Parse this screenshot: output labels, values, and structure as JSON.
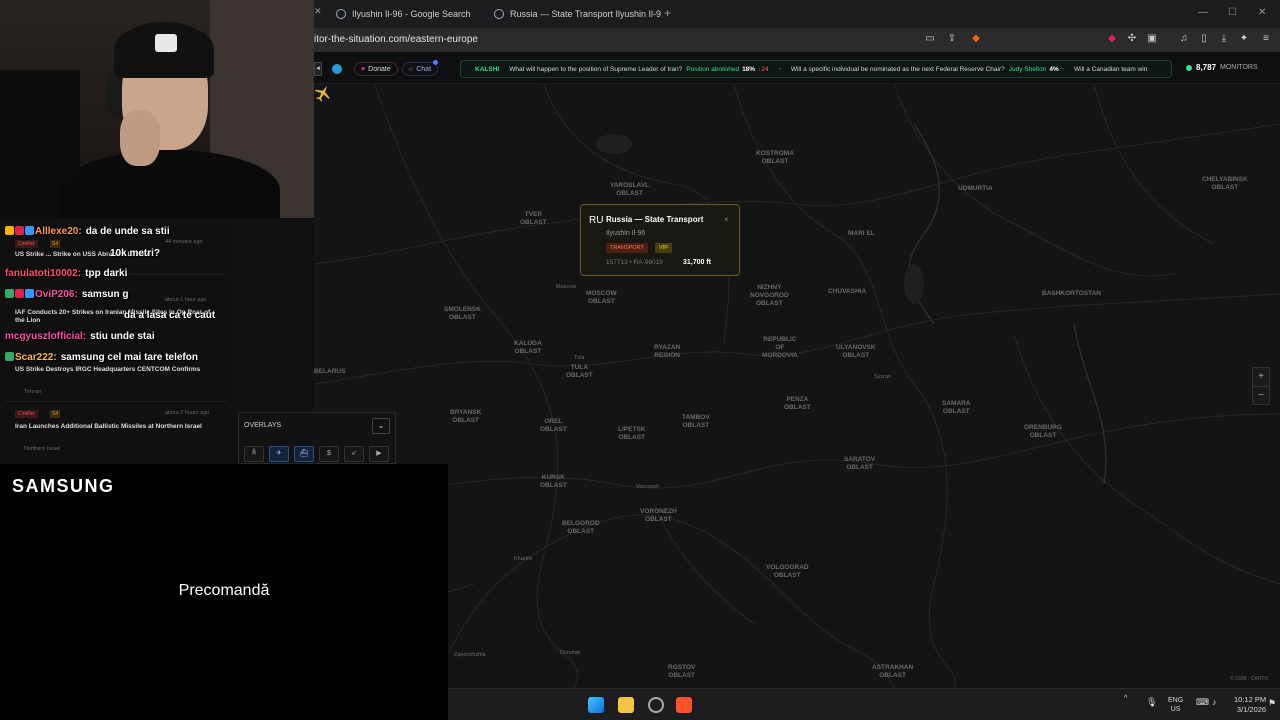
{
  "browser": {
    "tabs": [
      {
        "label": "Ilyushin Il-96 - Google Search",
        "active": false
      },
      {
        "label": "Russia — State Transport Ilyushin Il-9",
        "active": true
      }
    ],
    "new_tab_symbol": "+",
    "url": "itor-the-situation.com/eastern-europe"
  },
  "site": {
    "donate_label": "Donate",
    "chat_label": "Chat",
    "kalshi_label": "KALSHI",
    "ticker": [
      {
        "question": "What will happen to the position of Supreme Leader of Iran?",
        "answer": "Position abolished",
        "pct": "18%",
        "delta": "↓24"
      },
      {
        "question": "Will a specific individual be nominated as the next Federal Reserve Chair?",
        "answer": "Judy Shelton",
        "pct": "4%",
        "delta": ""
      },
      {
        "question": "Will a Canadian team win",
        "answer": "",
        "pct": "",
        "delta": ""
      }
    ],
    "monitors_count": "8,787",
    "monitors_label": "MONITORS"
  },
  "popup": {
    "flag": "RU",
    "title": "Russia — State Transport",
    "close": "×",
    "aircraft": "Ilyushin Il-96",
    "tag1": "TRANSPORT",
    "tag2": "VIP",
    "id_text": "157713 • RA-96019",
    "altitude": "31,700 ft"
  },
  "map": {
    "regions": [
      {
        "name": "YAROSLAVL\nOBLAST"
      },
      {
        "name": "KOSTROMA\nOBLAST"
      },
      {
        "name": "TVER\nOBLAST"
      },
      {
        "name": "MARI EL"
      },
      {
        "name": "UDMURTIA"
      },
      {
        "name": "MOSCOW\nOBLAST"
      },
      {
        "name": "NIZHNY\nNOVGOROD\nOBLAST"
      },
      {
        "name": "CHUVASHIA"
      },
      {
        "name": "SMOLENSK\nOBLAST"
      },
      {
        "name": "REPUBLIC\nOF\nMORDOVIA"
      },
      {
        "name": "KALUGA\nOBLAST"
      },
      {
        "name": "RYAZAN\nREGION"
      },
      {
        "name": "ULYANOVSK\nOBLAST"
      },
      {
        "name": "TULA\nOBLAST"
      },
      {
        "name": "BASHKORTOSTAN"
      },
      {
        "name": "BELARUS"
      },
      {
        "name": "BRYANSK\nOBLAST"
      },
      {
        "name": "OREL\nOBLAST"
      },
      {
        "name": "LIPETSK\nOBLAST"
      },
      {
        "name": "TAMBOV\nOBLAST"
      },
      {
        "name": "PENZA\nOBLAST"
      },
      {
        "name": "SAMARA\nOBLAST"
      },
      {
        "name": "ORENBURG\nOBLAST"
      },
      {
        "name": "KURSK\nOBLAST"
      },
      {
        "name": "SARATOV\nOBLAST"
      },
      {
        "name": "VORONEZH\nOBLAST"
      },
      {
        "name": "BELGOROD\nOBLAST"
      },
      {
        "name": "VOLGOGRAD\nOBLAST"
      },
      {
        "name": "ROSTOV\nOBLAST"
      },
      {
        "name": "ASTRAKHAN\nOBLAST"
      },
      {
        "name": "CHELYABINSK\nOBLAST"
      }
    ],
    "cities": [
      "Moscow",
      "Tula",
      "Voronezh",
      "Kharkiv",
      "Zaporizhzhia",
      "Donetsk",
      "Syzran"
    ],
    "zoom_in": "+",
    "zoom_out": "−",
    "attribution": "© OSM · CARTO"
  },
  "overlays": {
    "label": "OVERLAYS",
    "toggle": "⌄",
    "buttons": [
      "people-icon",
      "plane-icon",
      "ship-icon",
      "dollar-icon",
      "rocket-icon",
      "camera-icon"
    ]
  },
  "news": [
    {
      "category": "Conflict",
      "severity": "S4",
      "time": "44 minutes ago",
      "title": "US Strike ... Strike on USS Abraham Lincoln",
      "source": ""
    },
    {
      "category": "",
      "severity": "",
      "time": "about 1 hour ago",
      "title": "IAF Conducts 20+ Strikes on Iranian Missile Sites in Op Roar of the Lion",
      "source": ""
    },
    {
      "category": "",
      "severity": "",
      "time": "",
      "title": "US Strike Destroys IRGC Headquarters CENTCOM Confirms",
      "source": "Tehran"
    },
    {
      "category": "Conflict",
      "severity": "S4",
      "time": "about 2 hours ago",
      "title": "Iran Launches Additional Ballistic Missiles at Northern Israel",
      "source": "Northern Israel"
    }
  ],
  "chat": [
    {
      "user": "Alllexe20:",
      "text": "da de unde sa stii",
      "color": "#ff9a3c"
    },
    {
      "user": "",
      "text": "10k metri?",
      "color": "#6cf"
    },
    {
      "user": "fanulatoti10002:",
      "text": "tpp darki",
      "color": "#ff4d6d"
    },
    {
      "user": "OviP206:",
      "text": "samsun g",
      "color": "#ff4da6"
    },
    {
      "user": "",
      "text": "da a lasa ca te caut",
      "color": "#ff4da6"
    },
    {
      "user": "mcgyuszlofficial:",
      "text": "stiu unde stai",
      "color": "#ff4da6"
    },
    {
      "user": "Scar222:",
      "text": "samsung cel mai tare telefon",
      "color": "#ffb84d"
    }
  ],
  "ad": {
    "logo": "SAMSUNG",
    "cta": "Precomandă"
  },
  "taskbar": {
    "lang": "ENG",
    "region": "US",
    "time": "10:12 PM",
    "date": "3/1/2026",
    "tray_chevron": "^"
  }
}
